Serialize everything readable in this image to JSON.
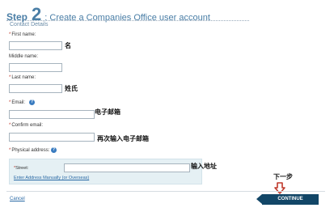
{
  "header": {
    "step_word": "Step",
    "step_number": "2",
    "title": ": Create a Companies Office user account"
  },
  "section": {
    "label": "Contact Details"
  },
  "fields": {
    "first_name": {
      "required_mark": "*",
      "label": "First name:",
      "value": "",
      "annotation": "名"
    },
    "middle_name": {
      "label": "Middle name:",
      "value": ""
    },
    "last_name": {
      "required_mark": "*",
      "label": "Last name:",
      "value": "",
      "annotation": "姓氏"
    },
    "email": {
      "required_mark": "*",
      "label": "Email:",
      "value": "",
      "annotation": "电子邮箱",
      "help_icon": "question-icon",
      "help_glyph": "?"
    },
    "confirm_email": {
      "required_mark": "*",
      "label": "Confirm email:",
      "value": "",
      "annotation": "再次输入电子邮箱"
    },
    "physical_address": {
      "required_mark": "*",
      "label": "Physical address:",
      "help_icon": "question-icon",
      "help_glyph": "?"
    },
    "street": {
      "required_mark": "*",
      "label": "Street:",
      "value": "",
      "annotation": "输入地址"
    }
  },
  "address": {
    "manual_link": "Enter Address Manually (or Overseas)"
  },
  "footer": {
    "cancel_label": "Cancel",
    "continue_label": "CONTINUE",
    "next_step_annotation": "下一步"
  },
  "colors": {
    "accent": "#4a7ea6",
    "link": "#2b6aa5",
    "button": "#124667",
    "panel": "#e5f0f4",
    "annotation_arrow": "#c0392b"
  }
}
